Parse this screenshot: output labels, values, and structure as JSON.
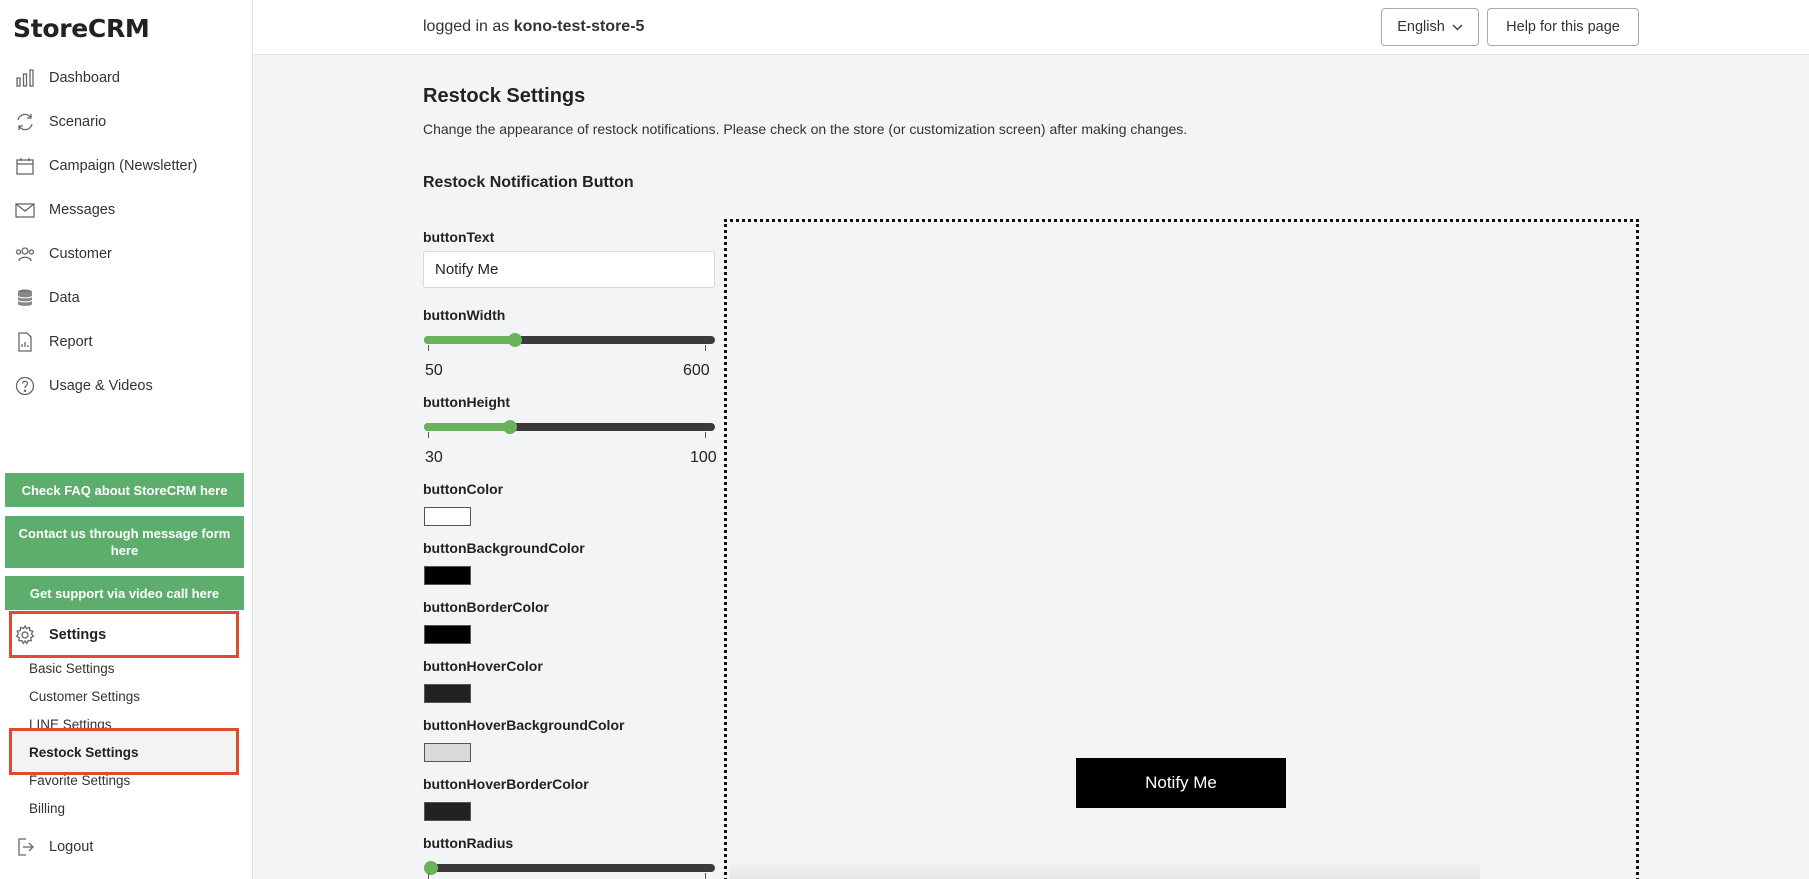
{
  "app": {
    "logo": "StoreCRM"
  },
  "sidebar": {
    "items": [
      {
        "label": "Dashboard",
        "icon": "bar-chart-icon"
      },
      {
        "label": "Scenario",
        "icon": "refresh-icon"
      },
      {
        "label": "Campaign (Newsletter)",
        "icon": "calendar-icon"
      },
      {
        "label": "Messages",
        "icon": "mail-icon"
      },
      {
        "label": "Customer",
        "icon": "users-icon"
      },
      {
        "label": "Data",
        "icon": "database-icon"
      },
      {
        "label": "Report",
        "icon": "document-chart-icon"
      },
      {
        "label": "Usage & Videos",
        "icon": "question-circle-icon"
      }
    ],
    "support_buttons": [
      "Check FAQ about StoreCRM here",
      "Contact us through message form here",
      "Get support via video call here"
    ],
    "settings_label": "Settings",
    "settings_sub": [
      "Basic Settings",
      "Customer Settings",
      "LINE Settings",
      "Restock Settings",
      "Favorite Settings",
      "Billing"
    ],
    "logout_label": "Logout",
    "support_button_color": "#5dad6d",
    "highlight_color": "#e04a2f"
  },
  "header": {
    "logged_in_prefix": "logged in as",
    "store_name": "kono-test-store-5",
    "language": "English",
    "help_button": "Help for this page"
  },
  "main": {
    "title": "Restock Settings",
    "description": "Change the appearance of restock notifications. Please check on the store (or customization screen) after making changes.",
    "section_title": "Restock Notification Button",
    "fields": {
      "buttonText": {
        "label": "buttonText",
        "value": "Notify Me"
      },
      "buttonWidth": {
        "label": "buttonWidth",
        "min": "50",
        "max": "600",
        "value": 216
      },
      "buttonHeight": {
        "label": "buttonHeight",
        "min": "30",
        "max": "100",
        "value": 50
      },
      "buttonColor": {
        "label": "buttonColor",
        "value": "#ffffff"
      },
      "buttonBackgroundColor": {
        "label": "buttonBackgroundColor",
        "value": "#000000"
      },
      "buttonBorderColor": {
        "label": "buttonBorderColor",
        "value": "#000000"
      },
      "buttonHoverColor": {
        "label": "buttonHoverColor",
        "value": "#222222"
      },
      "buttonHoverBackgroundColor": {
        "label": "buttonHoverBackgroundColor",
        "value": "#d9d9d9"
      },
      "buttonHoverBorderColor": {
        "label": "buttonHoverBorderColor",
        "value": "#222222"
      },
      "buttonRadius": {
        "label": "buttonRadius",
        "value": 0
      }
    },
    "preview": {
      "button_text": "Notify Me"
    }
  }
}
